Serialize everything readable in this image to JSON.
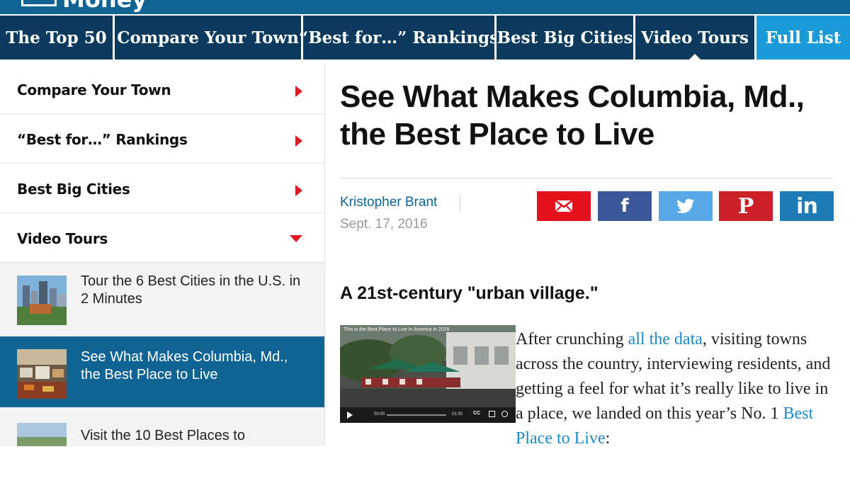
{
  "brand": {
    "name": "Money"
  },
  "nav": {
    "tabs": [
      {
        "label": "The Top 50"
      },
      {
        "label": "Compare Your Town"
      },
      {
        "label": "“Best for…” Rankings"
      },
      {
        "label": "Best Big Cities"
      },
      {
        "label": "Video Tours"
      },
      {
        "label": "Full List"
      }
    ],
    "active_tab": "Video Tours"
  },
  "sidebar": {
    "items": [
      {
        "label": "Compare Your Town",
        "icon": "chevron-right-icon"
      },
      {
        "label": "“Best for…” Rankings",
        "icon": "chevron-right-icon"
      },
      {
        "label": "Best Big Cities",
        "icon": "chevron-right-icon"
      },
      {
        "label": "Video Tours",
        "icon": "chevron-down-icon"
      }
    ],
    "videos": [
      {
        "title": "Tour the 6 Best Cities in the U.S. in 2 Minutes",
        "selected": false
      },
      {
        "title": "See What Makes Columbia, Md., the Best Place to Live",
        "selected": true
      },
      {
        "title": "Visit the 10 Best Places to",
        "selected": false
      }
    ]
  },
  "article": {
    "headline": "See What Makes Columbia, Md., the Best Place to Live",
    "author": "Kristopher Brant",
    "date": "Sept. 17, 2016",
    "subhead": "A 21st-century \"urban village.\"",
    "share": {
      "email_icon": "envelope-icon",
      "facebook_glyph": "f",
      "twitter_icon": "twitter-bird-icon",
      "pinterest_glyph": "P",
      "linkedin_glyph": "in"
    },
    "video": {
      "title": "This is the Best Place to Live in America in 2016",
      "time_start": "00:00",
      "time_end": "01:30",
      "cc_label": "CC"
    },
    "body": {
      "p1_a": "After crunching ",
      "p1_link1": "all the data",
      "p1_b": ", visiting towns across the country, interviewing residents, and getting a feel for what it’s really like to live in a place, we landed on this year’s No. 1 ",
      "p1_link2": "Best Place to Live",
      "p1_c": ":"
    }
  },
  "colors": {
    "brand_blue": "#0f6493",
    "nav_dark": "#0b3a5c",
    "nav_accent": "#1a9ad6",
    "arrow_red": "#e01a22",
    "link_blue": "#1a8ac9"
  }
}
